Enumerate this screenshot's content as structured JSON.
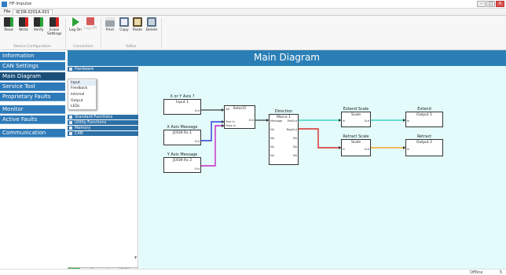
{
  "window": {
    "title": "HF-Impulse"
  },
  "menubar": {
    "file": "File",
    "tab": "XCDR-0201A-001"
  },
  "ribbon": {
    "device_configuration": {
      "group_label": "Device Configuration",
      "buttons": [
        "Read",
        "Write",
        "Verify",
        "Erase Settings"
      ]
    },
    "connection": {
      "group_label": "Connection",
      "buttons": [
        "Log On",
        "Log Off"
      ]
    },
    "editor": {
      "group_label": "Editor",
      "buttons": [
        "Print",
        "Copy",
        "Paste",
        "Delete"
      ]
    }
  },
  "nav": {
    "items": [
      "Information",
      "CAN Settings",
      "Main Diagram",
      "Service Tool",
      "Proprietary Faults",
      "Monitor",
      "Active Faults",
      "Communication"
    ],
    "active": "Main Diagram"
  },
  "page_title": "Main Diagram",
  "tree": {
    "sections": [
      "Hardware",
      "Standard Functions",
      "Utility Functions",
      "Memory",
      "CAN"
    ],
    "hardware_submenu": [
      "Input",
      "Feedback",
      "Internal",
      "Output",
      "LEDs"
    ]
  },
  "memory": {
    "label": "Memory Usage: 17.5%",
    "percent": 17.5
  },
  "diagram": {
    "blocks": {
      "input1": {
        "caption": "X or Y Axis ?",
        "title": "Input 1",
        "port_out": "Out"
      },
      "j1939rx1": {
        "caption": "X Axis Message",
        "title": "J1939 Rx 1",
        "port_out": "Out"
      },
      "j1939rx2": {
        "caption": "Y Axis Message",
        "title": "J1939 Rx 2",
        "port_out": "Out"
      },
      "select1": {
        "caption": "",
        "title": "Select1",
        "port_sel": "Sel",
        "port_true": "True In",
        "port_false": "False In",
        "port_out": "Out"
      },
      "macro1": {
        "caption": "Direction Control",
        "title": "Macro 1",
        "port_message": "Message",
        "port_posout": "PosOut",
        "port_negout": "NegOut",
        "na": "NA"
      },
      "scale_extend": {
        "caption": "Extend Scale",
        "title": "Scale",
        "port_in": "In",
        "port_out": "Out"
      },
      "scale_retract": {
        "caption": "Retract Scale",
        "title": "Scale",
        "port_in": "In",
        "port_out": "Out"
      },
      "output1": {
        "caption": "Extend",
        "title": "Output 1",
        "port_in": "In"
      },
      "output2": {
        "caption": "Retract",
        "title": "Output 2",
        "port_in": "In"
      }
    },
    "wire_colors": {
      "blue": "#2b3cd6",
      "magenta": "#c626c2",
      "teal": "#38d4c2",
      "red": "#d62a2a",
      "orange": "#f0a52a",
      "black": "#111111"
    }
  },
  "status": {
    "connection": "Offline",
    "number": "5"
  },
  "colors": {
    "nav": "#2e7ab8",
    "nav_active": "#1a4f7a",
    "header": "#2a7fb6",
    "canvas": "#e4fbfb"
  }
}
